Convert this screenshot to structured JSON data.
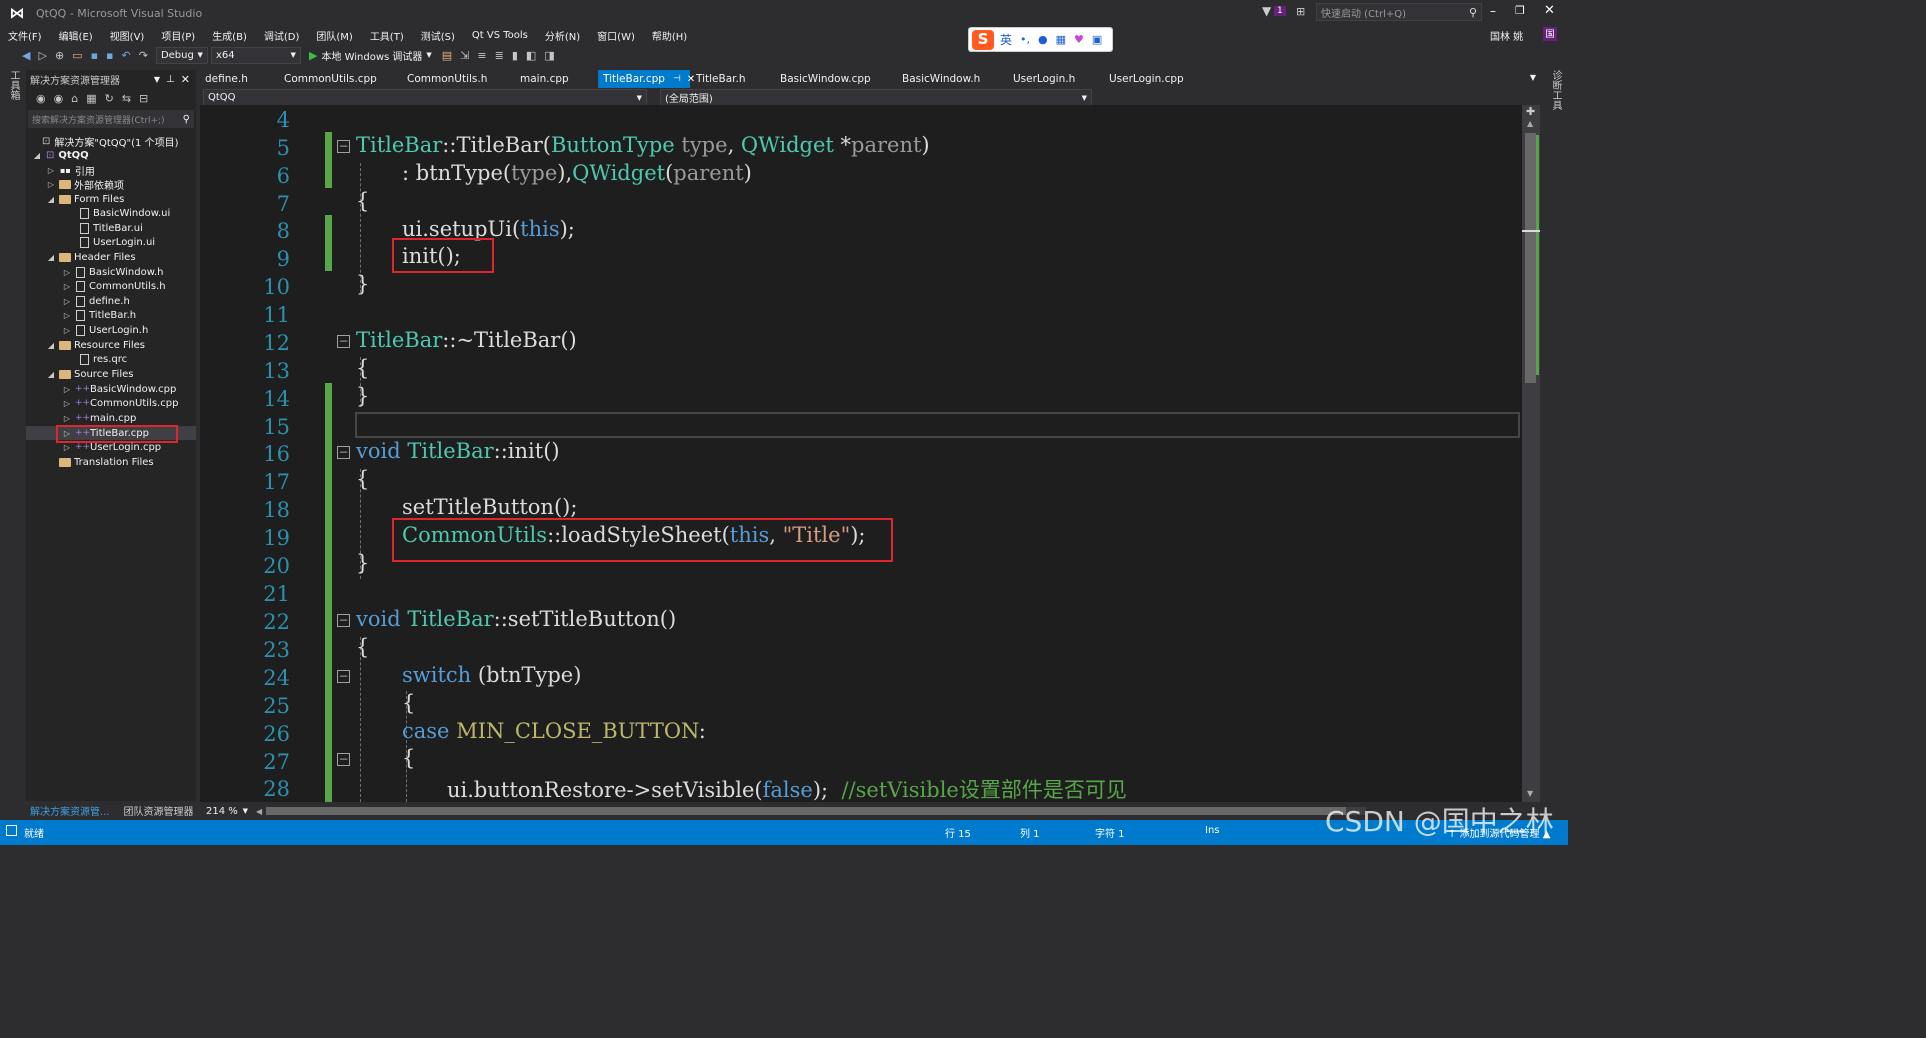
{
  "window": {
    "title": "QtQQ - Microsoft Visual Studio",
    "quick_launch_placeholder": "快速启动 (Ctrl+Q)",
    "user": "国林 姚",
    "notification_count": "1"
  },
  "menu": [
    "文件(F)",
    "编辑(E)",
    "视图(V)",
    "项目(P)",
    "生成(B)",
    "调试(D)",
    "团队(M)",
    "工具(T)",
    "测试(S)",
    "Qt VS Tools",
    "分析(N)",
    "窗口(W)",
    "帮助(H)"
  ],
  "toolbar": {
    "config": "Debug",
    "platform": "x64",
    "debugger": "本地 Windows 调试器"
  },
  "ime": {
    "lang": "英"
  },
  "left_strip": {
    "label": "工具箱"
  },
  "right_strip": {
    "label": "诊断工具"
  },
  "solution": {
    "panel_title": "解决方案资源管理器",
    "search_placeholder": "搜索解决方案资源管理器(Ctrl+;)",
    "root": "解决方案\"QtQQ\"(1 个项目)",
    "project": "QtQQ",
    "items": [
      {
        "label": "引用"
      },
      {
        "label": "外部依赖项"
      },
      {
        "label": "Form Files"
      },
      {
        "label": "BasicWindow.ui"
      },
      {
        "label": "TitleBar.ui"
      },
      {
        "label": "UserLogin.ui"
      },
      {
        "label": "Header Files"
      },
      {
        "label": "BasicWindow.h"
      },
      {
        "label": "CommonUtils.h"
      },
      {
        "label": "define.h"
      },
      {
        "label": "TitleBar.h"
      },
      {
        "label": "UserLogin.h"
      },
      {
        "label": "Resource Files"
      },
      {
        "label": "res.qrc"
      },
      {
        "label": "Source Files"
      },
      {
        "label": "BasicWindow.cpp"
      },
      {
        "label": "CommonUtils.cpp"
      },
      {
        "label": "main.cpp"
      },
      {
        "label": "TitleBar.cpp"
      },
      {
        "label": "UserLogin.cpp"
      },
      {
        "label": "Translation Files"
      }
    ],
    "bottom_tabs": [
      "解决方案资源管...",
      "团队资源管理器"
    ]
  },
  "tabs": [
    "define.h",
    "CommonUtils.cpp",
    "CommonUtils.h",
    "main.cpp",
    "TitleBar.cpp",
    "TitleBar.h",
    "BasicWindow.cpp",
    "BasicWindow.h",
    "UserLogin.h",
    "UserLogin.cpp"
  ],
  "nav": {
    "project": "QtQQ",
    "scope": "(全局范围)"
  },
  "editor": {
    "line_numbers": [
      "4",
      "5",
      "6",
      "7",
      "8",
      "9",
      "10",
      "11",
      "12",
      "13",
      "14",
      "15",
      "16",
      "17",
      "18",
      "19",
      "20",
      "21",
      "22",
      "23",
      "24",
      "25",
      "26",
      "27",
      "28"
    ],
    "zoom": "214 %"
  },
  "code": {
    "l5": {
      "a": "TitleBar",
      "b": "::",
      "c": "TitleBar",
      "d": "(",
      "e": "ButtonType",
      "f": " type",
      "g": ", ",
      "h": "QWidget",
      "i": " *",
      "j": "parent",
      "k": ")"
    },
    "l6": {
      "a": ": btnType(",
      "b": "type",
      "c": "),",
      "d": "QWidget",
      "e": "(",
      "f": "parent",
      "g": ")"
    },
    "l7": "{",
    "l8": {
      "a": "ui.setupUi(",
      "b": "this",
      "c": ");"
    },
    "l9": "init();",
    "l10": "}",
    "l12": {
      "a": "TitleBar",
      "b": "::~TitleBar()"
    },
    "l13": "{",
    "l14": "}",
    "l16": {
      "a": "void",
      "b": " ",
      "c": "TitleBar",
      "d": "::init()"
    },
    "l17": "{",
    "l18": "setTitleButton();",
    "l19": {
      "a": "CommonUtils",
      "b": "::loadStyleSheet(",
      "c": "this",
      "d": ", ",
      "e": "\"Title\"",
      "f": ");"
    },
    "l20": "}",
    "l22": {
      "a": "void",
      "b": " ",
      "c": "TitleBar",
      "d": "::setTitleButton()"
    },
    "l23": "{",
    "l24": {
      "a": "switch",
      "b": " (btnType)"
    },
    "l25": "{",
    "l26": {
      "a": "case",
      "b": " ",
      "c": "MIN_CLOSE_BUTTON",
      "d": ":"
    },
    "l27": "{",
    "l28": {
      "a": "ui.buttonRestore->setVisible(",
      "b": "false",
      "c": ");  ",
      "d": "//setVisible设置部件是否可见"
    }
  },
  "status": {
    "ready": "就绪",
    "line": "行 15",
    "col": "列 1",
    "char": "字符 1",
    "ins": "Ins",
    "scm": "↑ 添加到源代码管理 ▲"
  },
  "watermark": "CSDN @国中之林",
  "colors": {
    "accent": "#007acc",
    "highlight_box": "#e0262d",
    "change_bar": "#57a64a"
  }
}
